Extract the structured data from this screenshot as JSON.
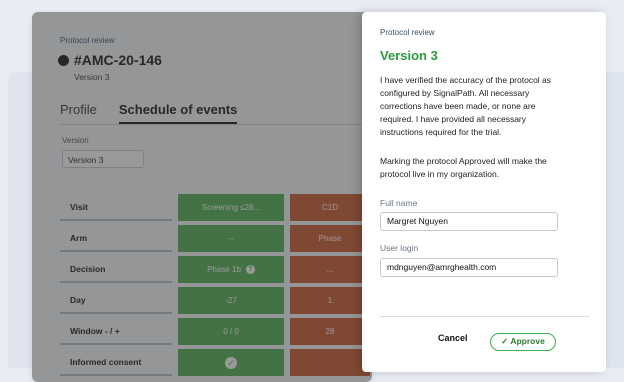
{
  "protocol": {
    "eyebrow": "Protocol review",
    "id": "#AMC-20-146",
    "version": "Version 3"
  },
  "tabs": [
    {
      "label": "Profile",
      "active": false
    },
    {
      "label": "Schedule of events",
      "active": true
    }
  ],
  "version_select": {
    "label": "Version",
    "value": "Version 3"
  },
  "schedule": {
    "rows": [
      {
        "label": "Visit",
        "cells": [
          "Screening ≤28...",
          "C1D"
        ]
      },
      {
        "label": "Arm",
        "cells": [
          "--",
          "Phase"
        ]
      },
      {
        "label": "Decision",
        "cells": [
          "Phase 1b",
          "..."
        ]
      },
      {
        "label": "Day",
        "cells": [
          "-27",
          "1"
        ]
      },
      {
        "label": "Window - / +",
        "cells": [
          "0 / 0",
          "28"
        ]
      },
      {
        "label": "Informed consent",
        "cells": [
          "",
          ""
        ]
      }
    ],
    "colors": {
      "green": "#4caf50",
      "orange": "#c9572a"
    }
  },
  "panel": {
    "eyebrow": "Protocol review",
    "title": "Version 3",
    "para1": "I have verified the accuracy of the protocol as configured by SignalPath. All necessary corrections have been made, or none are required. I have provided all necessary instructions required for the trial.",
    "para2": "Marking the protocol Approved will make the protocol live in my organization.",
    "full_name_label": "Full name",
    "full_name_value": "Margret Nguyen",
    "user_login_label": "User login",
    "user_login_value": "mdnguyen@amrghealth.com",
    "cancel_label": "Cancel",
    "approve_label": "Approve",
    "accent": "#2e9b3f"
  },
  "icons": {
    "info": "info-icon",
    "check": "check-icon",
    "approve": "check-icon"
  }
}
